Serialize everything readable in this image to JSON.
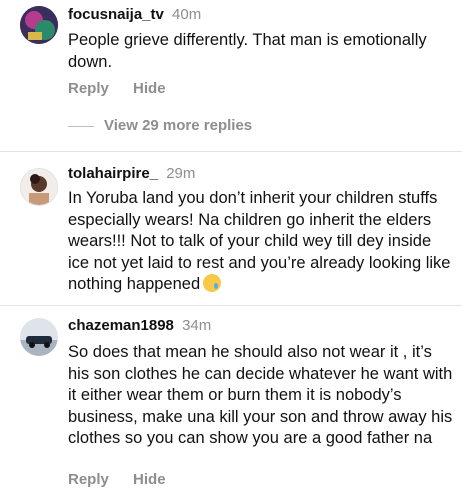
{
  "comments": [
    {
      "username": "focusnaija_tv",
      "time": "40m",
      "text": "People grieve differently. That man is emotionally down.",
      "reply_label": "Reply",
      "hide_label": "Hide",
      "view_more": "View 29 more replies"
    },
    {
      "username": "tolahairpire_",
      "time": "29m",
      "text": "In Yoruba land you don’t inherit your children stuffs especially wears! Na children go inherit the elders wears!!! Not to talk of your child wey till dey inside ice not yet laid to rest and you’re already looking like nothing happened",
      "emoji": "crying-face"
    },
    {
      "username": "chazeman1898",
      "time": "34m",
      "text": "So does that mean he should also not wear it , it’s his son clothes he can decide whatever he want with it either wear them or burn them it is nobody’s business, make una kill your son and throw away his clothes so you can show you are a good father na",
      "reply_label": "Reply",
      "hide_label": "Hide"
    }
  ],
  "colors": {
    "text": "#111111",
    "muted": "#8e8e8e",
    "divider": "#e3e3e3"
  }
}
